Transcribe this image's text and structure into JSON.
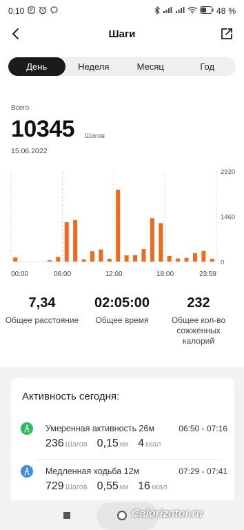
{
  "status_bar": {
    "time": "0:10",
    "battery": "48",
    "icons": [
      "notification-icon",
      "alarm-icon",
      "viber-icon",
      "bluetooth-icon",
      "signal-icon",
      "signal-icon",
      "wifi-icon",
      "battery-icon"
    ]
  },
  "header": {
    "title": "Шаги",
    "back_icon": "chevron-left-icon",
    "share_icon": "share-icon"
  },
  "tabs": [
    {
      "label": "День",
      "active": true
    },
    {
      "label": "Неделя",
      "active": false
    },
    {
      "label": "Месяц",
      "active": false
    },
    {
      "label": "Год",
      "active": false
    }
  ],
  "summary": {
    "label": "Всего",
    "value": "10345",
    "unit": "Шагов",
    "date": "15.06.2022"
  },
  "chart_data": {
    "type": "bar",
    "x": [
      0.5,
      4.5,
      5.5,
      6.5,
      7.5,
      8.5,
      9.5,
      10.5,
      11.5,
      12.5,
      13.5,
      14.5,
      15.5,
      16.5,
      17.5,
      18.5,
      19.5,
      20.5,
      21.5,
      22.5,
      23.5
    ],
    "values": [
      130,
      40,
      150,
      1270,
      1340,
      70,
      330,
      390,
      90,
      2320,
      200,
      210,
      400,
      1400,
      1240,
      180,
      100,
      120,
      270,
      340,
      90
    ],
    "xtick_labels": [
      "00:00",
      "06:00",
      "12:00",
      "18:00",
      "23:59"
    ],
    "xtick_values": [
      0,
      6,
      12,
      18,
      24
    ],
    "ytick_labels": [
      "2920",
      "1460",
      "0"
    ],
    "yticks": [
      2920,
      1460,
      0
    ],
    "xlim": [
      0,
      24
    ],
    "ylim": [
      0,
      2920
    ],
    "color": "#ef6a1a",
    "grid": "vertical dashed"
  },
  "stats": [
    {
      "value": "7,34",
      "label": "Общее расстояние"
    },
    {
      "value": "02:05:00",
      "label": "Общее время"
    },
    {
      "value": "232",
      "label": "Общее кол-во сожженных калорий"
    }
  ],
  "activity": {
    "title": "Активность сегодня:",
    "items": [
      {
        "icon": "walking-person-icon",
        "icon_color": "#2bbb5a",
        "name": "Умеренная активность 26м",
        "time": "06:50 - 07:16",
        "steps": "236",
        "steps_unit": "Шагов",
        "distance": "0,15",
        "distance_unit": "км",
        "calories": "4",
        "calories_unit": "ккал"
      },
      {
        "icon": "walking-person-icon",
        "icon_color": "#3d8ce8",
        "name": "Медленная ходьба 12м",
        "time": "07:29 - 07:41",
        "steps": "729",
        "steps_unit": "Шагов",
        "distance": "0,55",
        "distance_unit": "км",
        "calories": "16",
        "calories_unit": "ккал"
      }
    ]
  },
  "watermark": "Calorizator.ru"
}
